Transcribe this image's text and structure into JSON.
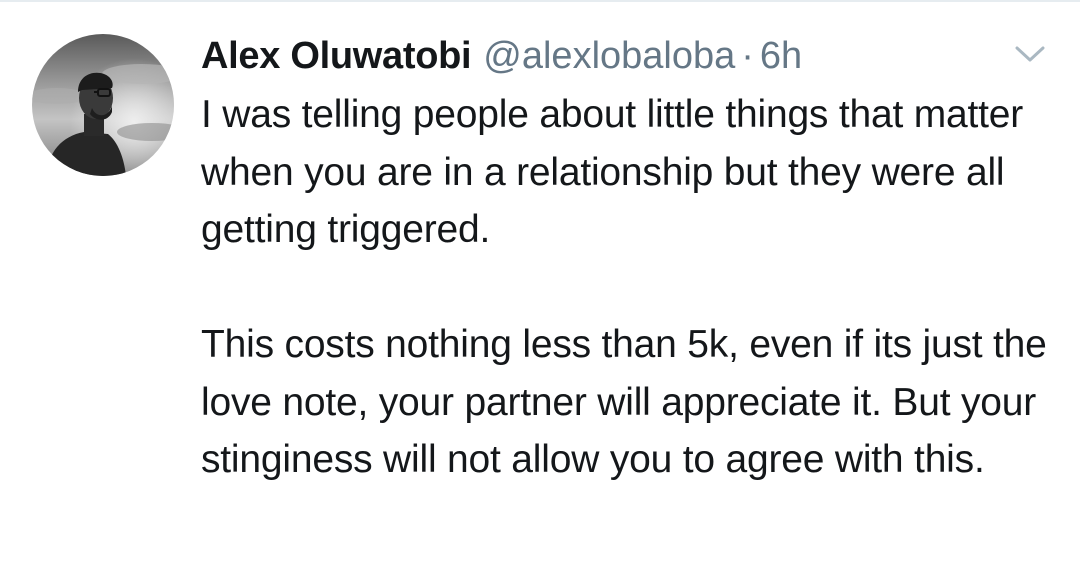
{
  "tweet": {
    "author_name": "Alex Oluwatobi",
    "handle": "@alexlobaloba",
    "separator": "·",
    "time": "6h",
    "paragraphs": [
      "I was telling people about little things that matter when you are in a relationship but they were all getting triggered.",
      "This costs nothing less than 5k, even if its just the love note, your partner will appreciate it. But your stinginess will not allow you to agree with this."
    ]
  },
  "icons": {
    "menu": "chevron-down-icon",
    "avatar": "profile-photo"
  },
  "colors": {
    "text": "#14171a",
    "secondary": "#657786",
    "divider": "#e6ecf0",
    "caret": "#aab8c2"
  }
}
